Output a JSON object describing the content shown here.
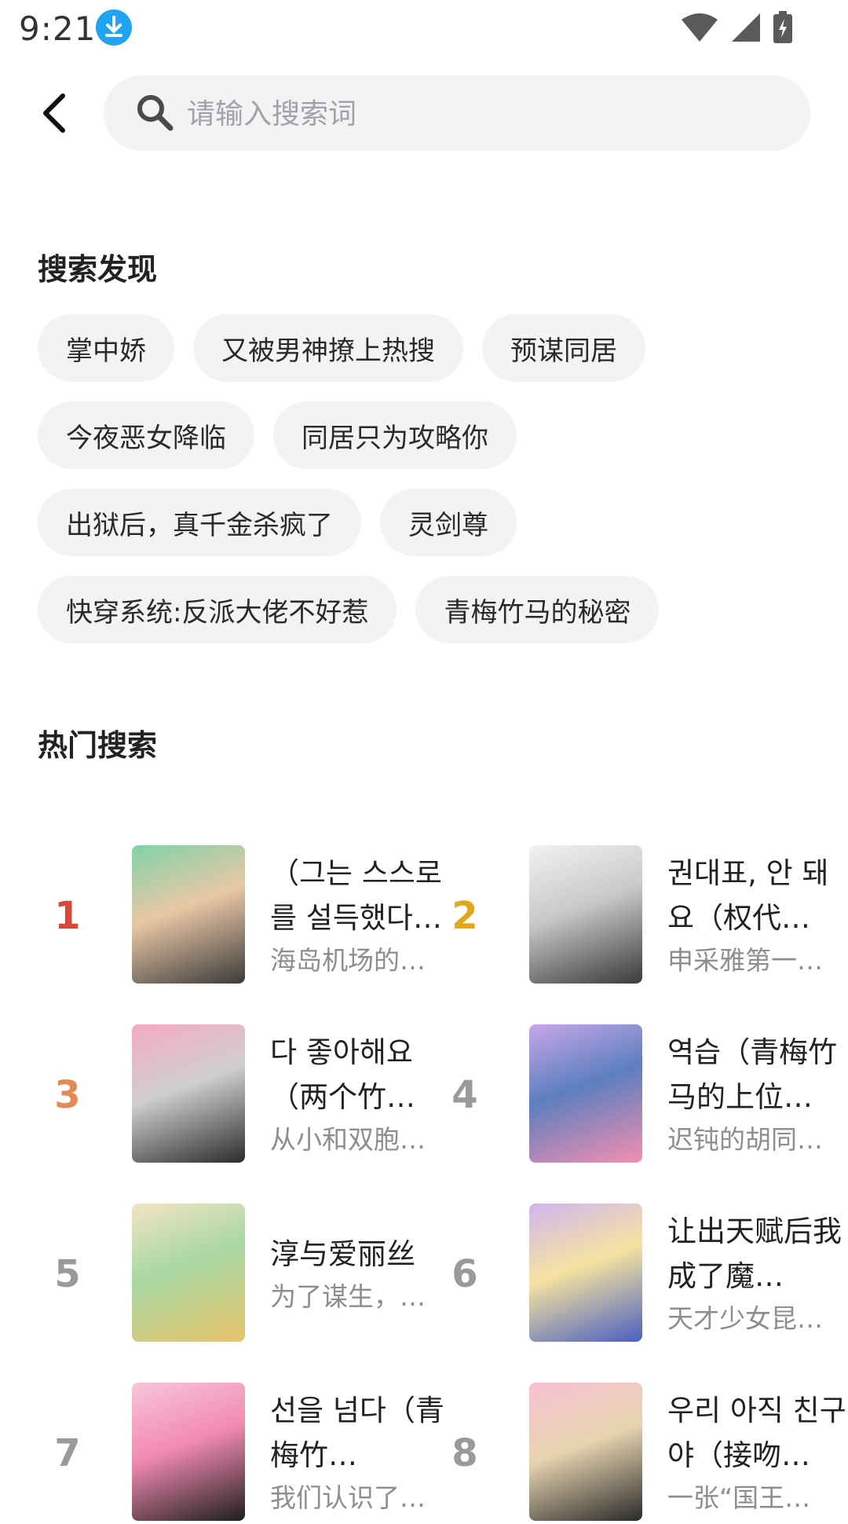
{
  "status_bar": {
    "time": "9:21"
  },
  "search": {
    "placeholder": "请输入搜索词"
  },
  "discover": {
    "title": "搜索发现",
    "tags": [
      "掌中娇",
      "又被男神撩上热搜",
      "预谋同居",
      "今夜恶女降临",
      "同居只为攻略你",
      "出狱后，真千金杀疯了",
      "灵剑尊",
      "快穿系统:反派大佬不好惹",
      "青梅竹马的秘密"
    ]
  },
  "hot": {
    "title": "热门搜索",
    "items": [
      {
        "rank": "1",
        "title": "（그는 스스로를 설득했다…",
        "desc": "海岛机场的…",
        "rank_color": "#d9473a",
        "cover_colors": [
          "#7fd3a8",
          "#3b3b3b",
          "#e9c7a5"
        ]
      },
      {
        "rank": "2",
        "title": "권대표, 안 돼요（权代…",
        "desc": "申采雅第一…",
        "rank_color": "#e3a71b",
        "cover_colors": [
          "#f2f2f2",
          "#3a3a3a",
          "#c8c8c8"
        ]
      },
      {
        "rank": "3",
        "title": "다 좋아해요（两个竹…",
        "desc": "从小和双胞…",
        "rank_color": "#e08a56",
        "cover_colors": [
          "#f5a9c4",
          "#2c2c2c",
          "#cfcfcf"
        ]
      },
      {
        "rank": "4",
        "title": "역습（青梅竹马的上位…",
        "desc": "迟钝的胡同…",
        "rank_color": "#9a9a9a",
        "cover_colors": [
          "#c8a7e8",
          "#f48fb1",
          "#5c7fbf"
        ]
      },
      {
        "rank": "5",
        "title": "淳与爱丽丝",
        "desc": "为了谋生，…",
        "rank_color": "#9a9a9a",
        "cover_colors": [
          "#f3e4c4",
          "#e8c46a",
          "#a7d7a2"
        ]
      },
      {
        "rank": "6",
        "title": "让出天赋后我成了魔…",
        "desc": "天才少女昆…",
        "rank_color": "#9a9a9a",
        "cover_colors": [
          "#cfb6f0",
          "#4a5fc1",
          "#f6e3a0"
        ]
      },
      {
        "rank": "7",
        "title": "선을 넘다（青梅竹…",
        "desc": "我们认识了…",
        "rank_color": "#9a9a9a",
        "cover_colors": [
          "#f7c6da",
          "#1e1e1e",
          "#f28ab2"
        ]
      },
      {
        "rank": "8",
        "title": "우리 아직 친구야（接吻…",
        "desc": "一张“国王…",
        "rank_color": "#9a9a9a",
        "cover_colors": [
          "#f7c0d3",
          "#2a2a2a",
          "#e8d5b0"
        ]
      }
    ]
  }
}
